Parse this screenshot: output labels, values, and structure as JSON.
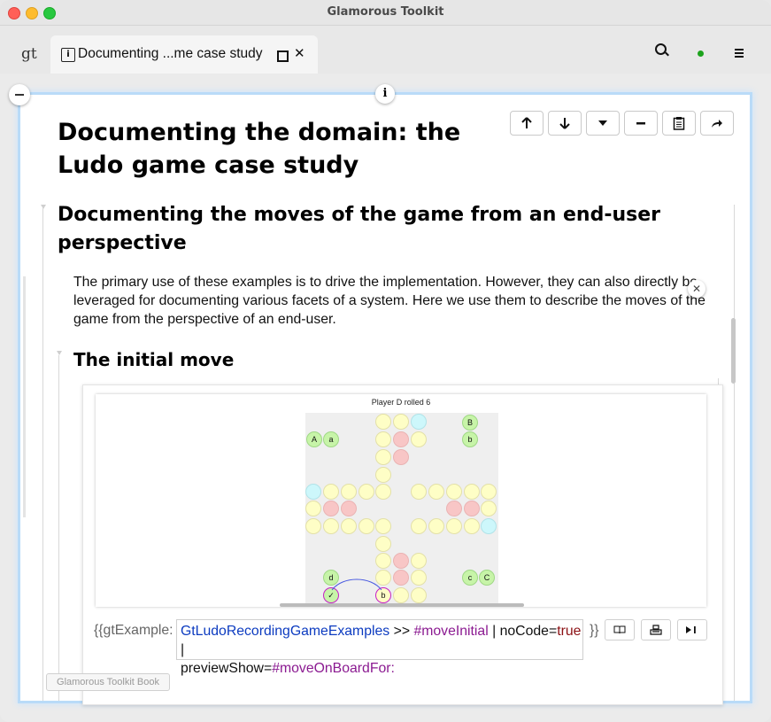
{
  "window": {
    "title": "Glamorous Toolkit"
  },
  "tabbar": {
    "logo": "gt",
    "tab_title": "Documenting ...me case study",
    "tab_icon": "i"
  },
  "page": {
    "title": "Documenting the domain: the Ludo game case study",
    "toolbar_icons": [
      "arrow-up-icon",
      "arrow-down-icon",
      "dropdown-icon",
      "minus-icon",
      "clipboard-icon",
      "share-icon"
    ],
    "section_heading": "Documenting the moves of the game from an end-user perspective",
    "paragraph": "The primary use of these examples is to drive the implementation. However, they can also directly be leveraged for documenting various facets of a system. Here we use them to describe the moves of the game from the perspective of an end-user.",
    "subsection_heading": "The initial move",
    "footer_button": "Glamorous Toolkit Book"
  },
  "example": {
    "roll_label": "Player D rolled 6",
    "source_prefix": "{{gtExample:",
    "source_class": "GtLudoRecordingGameExamples",
    "source_op": " >> ",
    "source_selector": "#moveInitial",
    "source_sep1": " | noCode=",
    "source_true": "true",
    "source_sep2": " |",
    "source_line2_key": "previewShow=",
    "source_line2_val": "#moveOnBoardFor:",
    "source_suffix": "}}",
    "colors": {
      "track": "#fefec6",
      "home_red": "#f8c6c6",
      "start_cyan": "#cdf7fb",
      "token_green": "#c7f4a8",
      "highlight": "#c61fc6"
    },
    "tokens": [
      "A",
      "a",
      "B",
      "b",
      "d",
      "c",
      "C",
      "b"
    ]
  }
}
